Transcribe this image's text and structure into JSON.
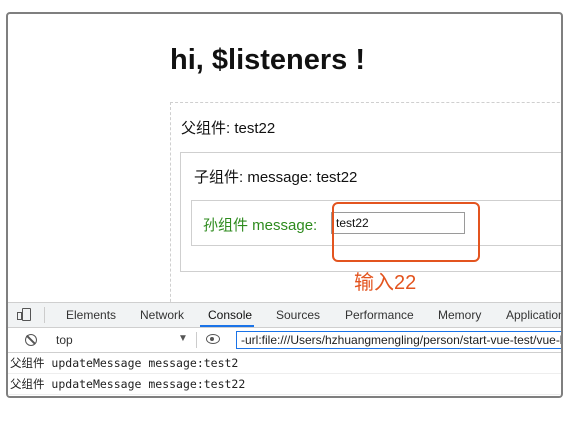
{
  "page": {
    "title": "hi, $listeners !",
    "parent_label": "父组件: test22",
    "child_label": "子组件: message: test22",
    "grandchild_label": "孙组件 message:",
    "input_value": "test22"
  },
  "annotation": {
    "text": "输入22",
    "color": "#e3541f"
  },
  "devtools": {
    "tabs": [
      "Elements",
      "Network",
      "Console",
      "Sources",
      "Performance",
      "Memory",
      "Application"
    ],
    "active_tab": "Console",
    "context": "top",
    "filter_value": "-url:file:///Users/hzhuangmengling/person/start-vue-test/vue-l",
    "logs": [
      "父组件 updateMessage message:test2",
      "父组件 updateMessage message:test22"
    ]
  },
  "colors": {
    "grandchild_text": "#2e8b1e",
    "active_tab_underline": "#1a73e8"
  }
}
